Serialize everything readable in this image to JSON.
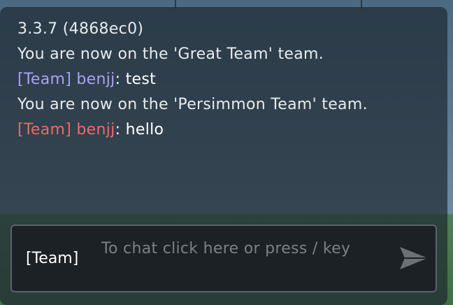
{
  "chat": {
    "messages": [
      {
        "type": "system",
        "text": "3.3.7 (4868ec0)"
      },
      {
        "type": "system",
        "text": "You are now on the 'Great Team' team."
      },
      {
        "type": "chat",
        "tag": "[Team]",
        "name": "benjj",
        "sep": ": ",
        "text": "test",
        "team_color": "#aaa2f4"
      },
      {
        "type": "system",
        "text": "You are now on the 'Persimmon Team' team."
      },
      {
        "type": "chat",
        "tag": "[Team]",
        "name": "benjj",
        "sep": ": ",
        "text": "hello",
        "team_color": "#ef6a63"
      }
    ]
  },
  "input": {
    "channel_label": "[Team]",
    "placeholder": "To chat click here or press / key"
  },
  "icons": {
    "send": "send-arrow-icon"
  }
}
